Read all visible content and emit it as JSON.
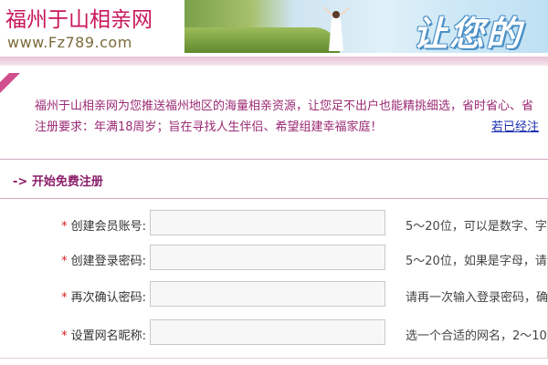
{
  "header": {
    "logo_title": "福州于山相亲网",
    "logo_url": "www.Fz789.com",
    "banner_text": "让您的"
  },
  "intro": {
    "line1": "福州于山相亲网为您推送福州地区的海量相亲资源，让您足不出户也能精挑细选，省时省心、省",
    "line2": "注册要求：年满18周岁；旨在寻找人生伴侣、希望组建幸福家庭！",
    "login_link": "若已经注"
  },
  "section": {
    "title": "-> 开始免费注册"
  },
  "form": {
    "required_mark": "*",
    "fields": [
      {
        "label": "创建会员账号:",
        "value": "",
        "hint": "5～20位，可以是数字、字"
      },
      {
        "label": "创建登录密码:",
        "value": "",
        "hint": "5～20位，如果是字母，请"
      },
      {
        "label": "再次确认密码:",
        "value": "",
        "hint": "请再一次输入登录密码，确"
      },
      {
        "label": "设置网名昵称:",
        "value": "",
        "hint": "选一个合适的网名，2～10"
      }
    ]
  },
  "colors": {
    "brand": "#c8175a",
    "section": "#8a1e6a",
    "link": "#1a2fb0",
    "required": "#d21e1e"
  }
}
